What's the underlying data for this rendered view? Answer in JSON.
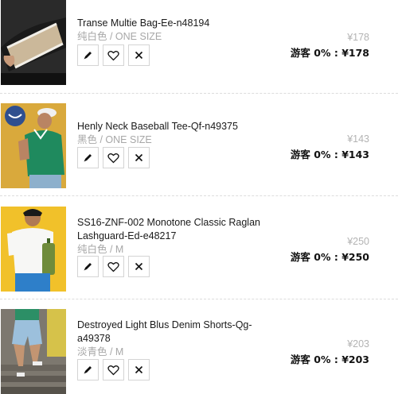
{
  "items": [
    {
      "name": "Transe Multie Bag-Ee-n48194",
      "variant": "纯白色 / ONE SIZE",
      "original_price": "¥178",
      "member_price": "游客 0% : ¥178",
      "thumb_icon": "bag-product-photo"
    },
    {
      "name": "Henly Neck Baseball Tee-Qf-n49375",
      "variant": "黑色 / ONE SIZE",
      "original_price": "¥143",
      "member_price": "游客 0% : ¥143",
      "thumb_icon": "tee-product-photo"
    },
    {
      "name": "SS16-ZNF-002 Monotone Classic Raglan Lashguard-Ed-e48217",
      "variant": "纯白色 / M",
      "original_price": "¥250",
      "member_price": "游客 0% : ¥250",
      "thumb_icon": "lashguard-product-photo"
    },
    {
      "name": "Destroyed Light Blus Denim Shorts-Qg-a49378",
      "variant": "淡青色 / M",
      "original_price": "¥203",
      "member_price": "游客 0% : ¥203",
      "thumb_icon": "shorts-product-photo"
    }
  ],
  "actions": {
    "edit_icon": "pencil-icon",
    "favorite_icon": "heart-icon",
    "remove_icon": "close-icon"
  },
  "colors": {
    "text": "#1a1a1a",
    "muted": "#a7a7a7",
    "border": "#d4d4d4",
    "divider": "#dcdcdc"
  }
}
